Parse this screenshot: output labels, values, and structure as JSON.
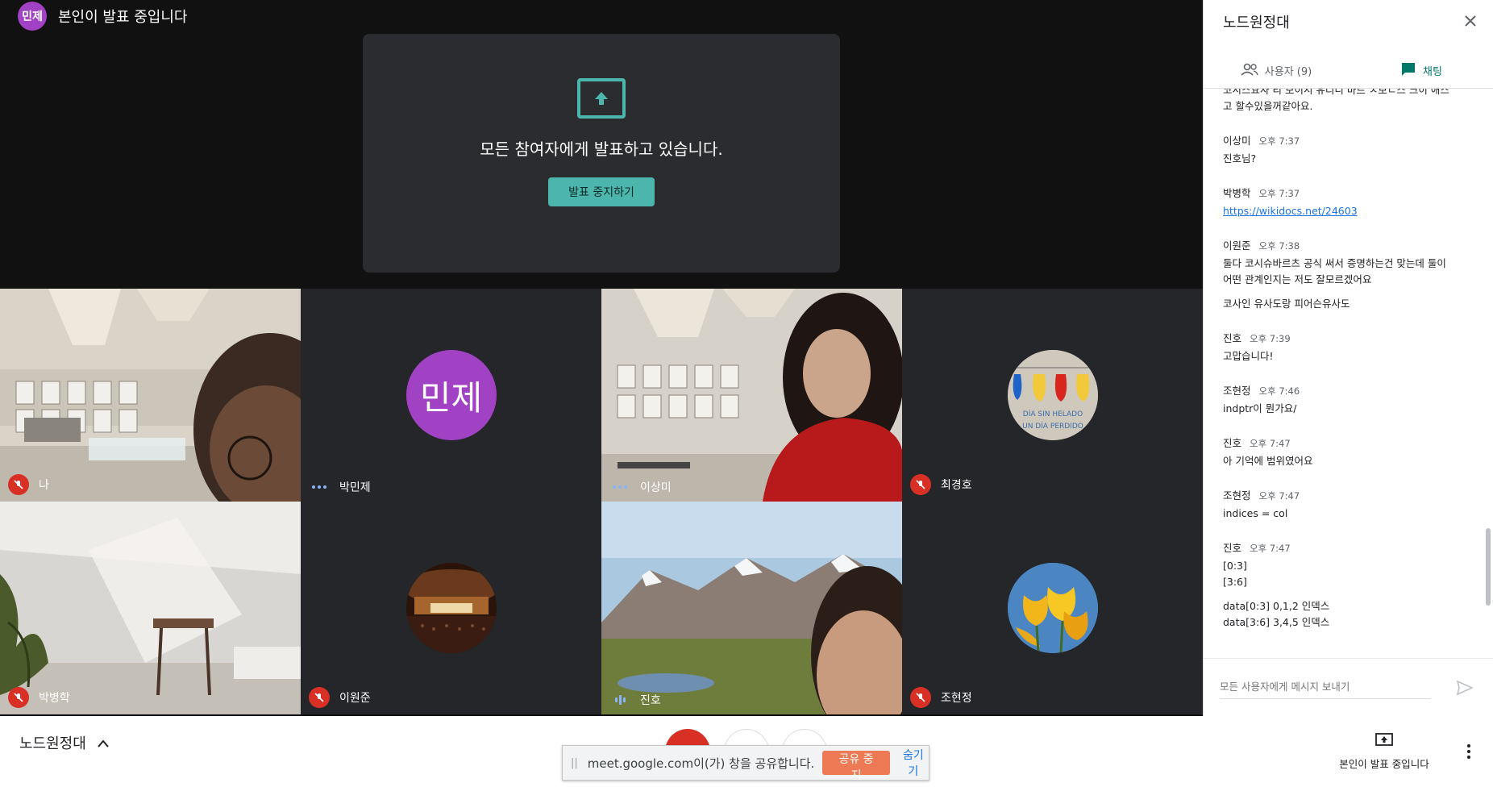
{
  "presenter": {
    "avatar_text": "민제",
    "label": "본인이 발표 중입니다"
  },
  "present_card": {
    "heading": "모든 참여자에게 발표하고 있습니다.",
    "stop_button": "발표 중지하기"
  },
  "tiles": [
    {
      "name": "나",
      "status": "muted"
    },
    {
      "name": "박민제",
      "status": "dots",
      "avatar_text": "민제"
    },
    {
      "name": "이상미",
      "status": "dots"
    },
    {
      "name": "최경호",
      "status": "muted",
      "avatar_text": "DÍA SIN HELADO\nUN DÍA PERDIDO"
    },
    {
      "name": "박병학",
      "status": "muted"
    },
    {
      "name": "이원준",
      "status": "muted"
    },
    {
      "name": "진호",
      "status": "speaking"
    },
    {
      "name": "조현정",
      "status": "muted"
    }
  ],
  "panel": {
    "title": "노드원정대",
    "tabs": [
      {
        "label": "사용자 (9)",
        "icon": "people-icon"
      },
      {
        "label": "채팅",
        "icon": "chat-icon",
        "active": true
      }
    ],
    "messages": [
      {
        "sender": "",
        "time": "",
        "lines": [
          "코시스요사 리 보이시 유디니 마르 ㅅ보ㄴ스 크이 애스",
          "고 할수있을꺼같아요."
        ]
      },
      {
        "sender": "이상미",
        "time": "오후 7:37",
        "lines": [
          "진호님?"
        ]
      },
      {
        "sender": "박병학",
        "time": "오후 7:37",
        "lines": [
          "https://wikidocs.net/24603"
        ],
        "link": true
      },
      {
        "sender": "이원준",
        "time": "오후 7:38",
        "lines": [
          "둘다 코시슈바르츠 공식 써서 증명하는건 맞는데 둘이",
          "어떤 관계인지는 저도 잘모르겠어요",
          "",
          "코사인 유사도랑 피어슨유사도"
        ]
      },
      {
        "sender": "진호",
        "time": "오후 7:39",
        "lines": [
          "고맙습니다!"
        ]
      },
      {
        "sender": "조현정",
        "time": "오후 7:46",
        "lines": [
          "indptr이 뭔가요/"
        ]
      },
      {
        "sender": "진호",
        "time": "오후 7:47",
        "lines": [
          "아 기억에 범위였어요"
        ]
      },
      {
        "sender": "조현정",
        "time": "오후 7:47",
        "lines": [
          "indices = col"
        ]
      },
      {
        "sender": "진호",
        "time": "오후 7:47",
        "lines": [
          "[0:3]",
          "[3:6]",
          "",
          "data[0:3]  0,1,2 인덱스",
          "data[3:6]  3,4,5 인덱스"
        ]
      }
    ],
    "compose_placeholder": "모든 사용자에게 메시지 보내기"
  },
  "bottom": {
    "meeting_name": "노드원정대",
    "share_notice": {
      "text": "meet.google.com이(가) 창을 공유합니다.",
      "stop": "공유 중지",
      "hide": "숨기기"
    },
    "present_now": "본인이 발표 중입니다"
  },
  "colors": {
    "accent": "#00796b",
    "present_teal": "#4db6ac",
    "mute_red": "#d93025",
    "avatar_purple": "#a142c4",
    "share_orange": "#ee7a55"
  }
}
